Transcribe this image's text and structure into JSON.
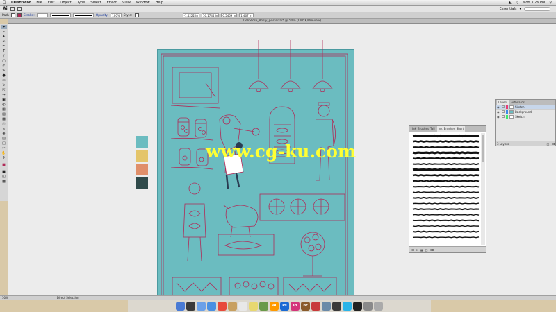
{
  "menubar": {
    "app_name": "Illustrator",
    "items": [
      "File",
      "Edit",
      "Object",
      "Type",
      "Select",
      "Effect",
      "View",
      "Window",
      "Help"
    ],
    "clock": "Mon 3:26 PM"
  },
  "appbar": {
    "logo": "Ai",
    "workspace": "Essentials",
    "workspace_icon": "chevron-down-icon"
  },
  "control": {
    "selection_label": "Path",
    "stroke_label": "Stroke:",
    "opacity_label": "Opacity:",
    "opacity_value": "100%",
    "style_label": "Style:",
    "x_value": "-1.4222 in",
    "y_value": "16.1744 in",
    "w_value": "0.5469 in",
    "h_value": "1.407 in"
  },
  "document": {
    "title": "DeliStore_Philly_poster.ai* @ 50% (CMYK/Preview)"
  },
  "artboard": {
    "background_color": "#6bbcc0",
    "line_color": "#b02a57"
  },
  "palette": {
    "colors": [
      "#6bbcc0",
      "#e4c56a",
      "#e08f6a",
      "#2f4a4a"
    ]
  },
  "layers_panel": {
    "tabs": [
      "Layers",
      "Artboards"
    ],
    "rows": [
      {
        "name": "Sketch",
        "color": "#e83b74",
        "selected": true
      },
      {
        "name": "Background",
        "color": "#3b8ae8",
        "selected": false
      },
      {
        "name": "Sketch",
        "color": "#3be86d",
        "selected": false
      }
    ],
    "footer_text": "3 Layers"
  },
  "brushes_panel": {
    "tabs": [
      "Ink_Brushes_Tall",
      "Ink_Brushes_Short"
    ],
    "brush_count": 19
  },
  "statusbar": {
    "zoom": "50%",
    "tool_hint": "Direct Selection"
  },
  "watermark": {
    "text": "www.cg-ku.com"
  },
  "dock": {
    "apps": [
      "Finder",
      "Dashboard",
      "Mail",
      "Safari",
      "Chrome",
      "Contacts",
      "Calendar",
      "Notes",
      "Photo",
      "Ai",
      "Ps",
      "Id",
      "Br",
      "Acrobat",
      "Preview",
      "FCP",
      "iTunes",
      "Terminal",
      "Prefs",
      "Trash"
    ]
  }
}
